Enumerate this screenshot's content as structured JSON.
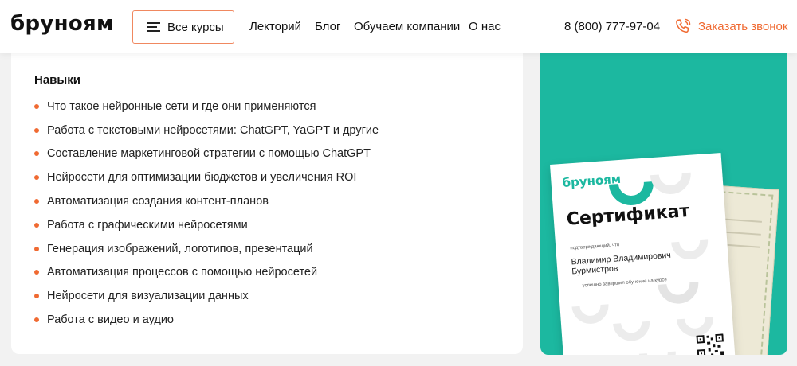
{
  "header": {
    "logo": "бруноям",
    "courses_button": "Все курсы",
    "nav": [
      "Лекторий",
      "Блог",
      "Обучаем компании",
      "О нас"
    ],
    "phone": "8 (800) 777-97-04",
    "callback": "Заказать звонок"
  },
  "skills": {
    "title": "Навыки",
    "items": [
      "Что такое нейронные сети и где они применяются",
      "Работа с текстовыми нейросетями: ChatGPT, YaGPT и другие",
      "Составление маркетинговой стратегии с помощью ChatGPT",
      "Нейросети для оптимизации бюджетов и увеличения ROI",
      "Автоматизация создания контент-планов",
      "Работа с графическими нейросетями",
      "Генерация изображений, логотипов, презентаций",
      "Автоматизация процессов с помощью нейросетей",
      "Нейросети для визуализации данных",
      "Работа с видео и аудио"
    ]
  },
  "certificate": {
    "brand": "бруноям",
    "title": "Сертификат",
    "confirm_text": "подтверждающий, что",
    "name_line1": "Владимир Владимирович",
    "name_line2": "Бурмистров",
    "course_text": "успешно завершил обучение на курсе"
  },
  "colors": {
    "accent": "#f06a32",
    "teal": "#1cb8a0",
    "background": "#f2f2f2"
  },
  "icons": {
    "menu": "hamburger-icon",
    "callback": "phone-call-icon",
    "bullet": "bullet-dot-icon",
    "qr": "qr-code-icon"
  }
}
